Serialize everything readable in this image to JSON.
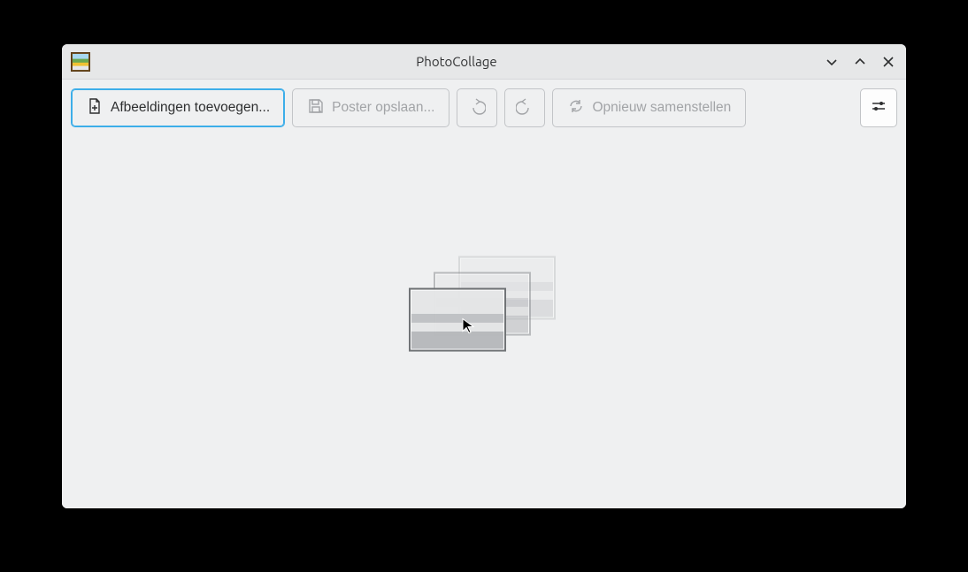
{
  "window": {
    "title": "PhotoCollage"
  },
  "toolbar": {
    "add_images_label": "Afbeeldingen toevoegen...",
    "save_poster_label": "Poster opslaan...",
    "recompose_label": "Opnieuw samenstellen"
  }
}
